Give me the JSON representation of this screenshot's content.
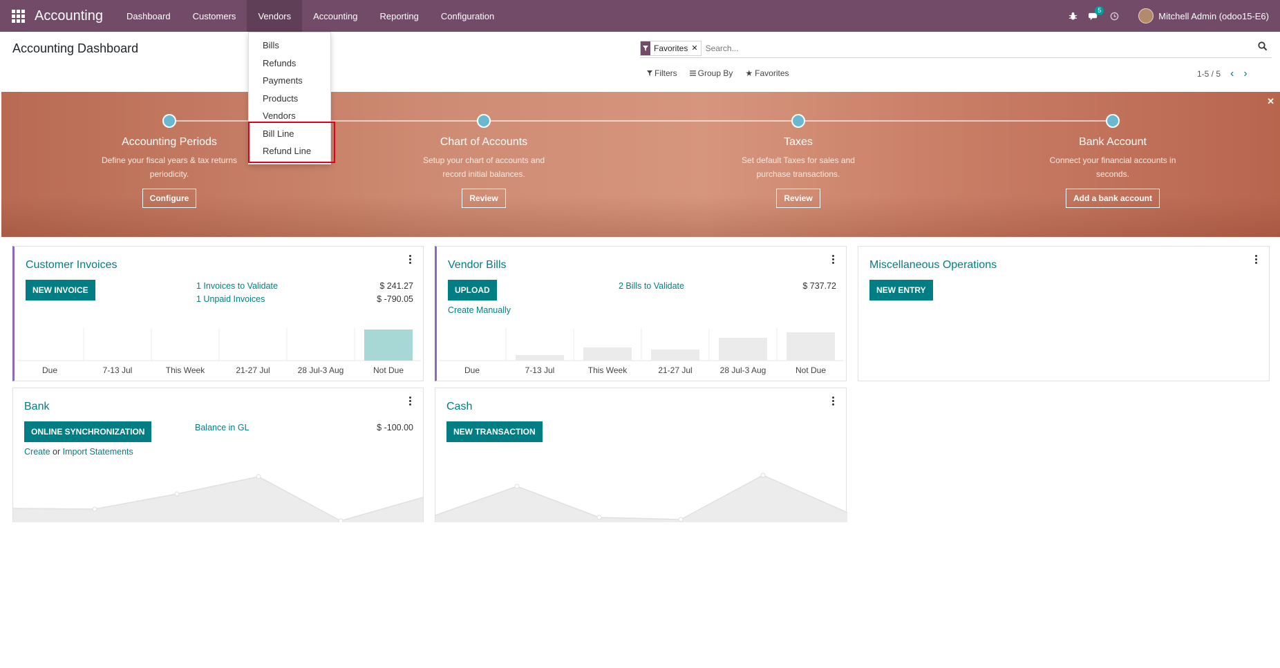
{
  "navbar": {
    "brand": "Accounting",
    "menu": [
      "Dashboard",
      "Customers",
      "Vendors",
      "Accounting",
      "Reporting",
      "Configuration"
    ],
    "active_menu": "Vendors",
    "chat_badge": "5",
    "user": "Mitchell Admin (odoo15-E6)",
    "accent_color": "#714B67"
  },
  "vendors_dropdown": [
    "Bills",
    "Refunds",
    "Payments",
    "Products",
    "Vendors",
    "Bill Line",
    "Refund Line"
  ],
  "control_panel": {
    "title": "Accounting Dashboard",
    "facet": "Favorites",
    "search_placeholder": "Search...",
    "filters": "Filters",
    "group_by": "Group By",
    "favorites": "Favorites",
    "pager": "1-5 / 5"
  },
  "onboarding": {
    "steps": [
      {
        "title": "Accounting Periods",
        "desc1": "Define your fiscal years & tax returns",
        "desc2": "periodicity.",
        "button": "Configure"
      },
      {
        "title": "Chart of Accounts",
        "desc1": "Setup your chart of accounts and",
        "desc2": "record initial balances.",
        "button": "Review"
      },
      {
        "title": "Taxes",
        "desc1": "Set default Taxes for sales and",
        "desc2": "purchase transactions.",
        "button": "Review"
      },
      {
        "title": "Bank Account",
        "desc1": "Connect your financial accounts in",
        "desc2": "seconds.",
        "button": "Add a bank account"
      }
    ]
  },
  "cards": {
    "customer_invoices": {
      "title": "Customer Invoices",
      "button": "NEW INVOICE",
      "line1": "1 Invoices to Validate",
      "amount1": "$ 241.27",
      "line2": "1 Unpaid Invoices",
      "amount2": "$ -790.05",
      "labels": [
        "Due",
        "7-13 Jul",
        "This Week",
        "21-27 Jul",
        "28 Jul-3 Aug",
        "Not Due"
      ]
    },
    "vendor_bills": {
      "title": "Vendor Bills",
      "button": "UPLOAD",
      "line1": "2 Bills to Validate",
      "amount1": "$ 737.72",
      "create": "Create Manually",
      "labels": [
        "Due",
        "7-13 Jul",
        "This Week",
        "21-27 Jul",
        "28 Jul-3 Aug",
        "Not Due"
      ]
    },
    "misc": {
      "title": "Miscellaneous Operations",
      "button": "NEW ENTRY"
    },
    "bank": {
      "title": "Bank",
      "button": "ONLINE SYNCHRONIZATION",
      "line1": "Balance in GL",
      "amount1": "$ -100.00",
      "create": "Create",
      "or": "or",
      "import": "Import Statements"
    },
    "cash": {
      "title": "Cash",
      "button": "NEW TRANSACTION"
    }
  }
}
